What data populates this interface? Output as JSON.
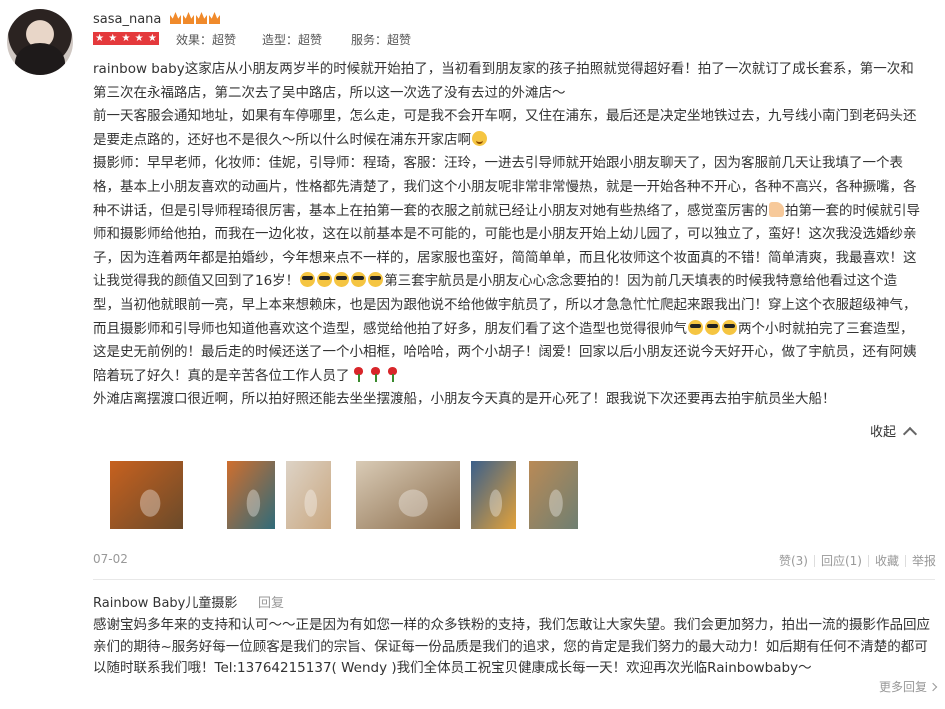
{
  "user": {
    "name": "sasa_nana",
    "crown_count": 4,
    "star_rating": 5,
    "ratings": [
      {
        "label": "效果：超赞"
      },
      {
        "label": "造型：超赞"
      },
      {
        "label": "服务：超赞"
      }
    ]
  },
  "review": {
    "paragraphs": [
      "rainbow baby这家店从小朋友两岁半的时候就开始拍了，当初看到朋友家的孩子拍照就觉得超好看！拍了一次就订了成长套系，第一次和第三次在永福路店，第二次去了吴中路店，所以这一次选了没有去过的外滩店～",
      "前一天客服会通知地址，如果有车停哪里，怎么走，可是我不会开车啊，又住在浦东，最后还是决定坐地铁过去，九号线小南门到老码头还是要走点路的，还好也不是很久～所以什么时候在浦东开家店啊",
      "摄影师：早早老师，化妆师：佳妮，引导师：程琦，客服：汪玲，一进去引导师就开始跟小朋友聊天了，因为客服前几天让我填了一个表格，基本上小朋友喜欢的动画片，性格都先清楚了，我们这个小朋友呢非常非常慢热，就是一开始各种不开心，各种不高兴，各种撅嘴，各种不讲话，但是引导师程琦很厉害，基本上在拍第一套的衣服之前就已经让小朋友对她有些热络了，感觉蛮厉害的",
      "拍第一套的时候就引导师和摄影师给他拍，而我在一边化妆，这在以前基本是不可能的，可能也是小朋友开始上幼儿园了，可以独立了，蛮好！这次我没选婚纱亲子，因为连着两年都是拍婚纱，今年想来点不一样的，居家服也蛮好，简简单单，而且化妆师这个妆面真的不错！简单清爽，我最喜欢！这让我觉得我的颜值又回到了16岁！",
      "第三套宇航员是小朋友心心念念要拍的！因为前几天填表的时候我特意给他看过这个造型，当初他就眼前一亮，早上本来想赖床，也是因为跟他说不给他做宇航员了，所以才急急忙忙爬起来跟我出门！穿上这个衣服超级神气，而且摄影师和引导师也知道他喜欢这个造型，感觉给他拍了好多，朋友们看了这个造型也觉得很帅气",
      "两个小时就拍完了三套造型，这是史无前例的！最后走的时候还送了一个小相框，哈哈哈，两个小胡子！阔爱！回家以后小朋友还说今天好开心，做了宇航员，还有阿姨陪着玩了好久！真的是辛苦各位工作人员了",
      "外滩店离摆渡口很近啊，所以拍好照还能去坐坐摆渡船，小朋友今天真的是开心死了！跟我说下次还要再去拍宇航员坐大船！"
    ],
    "collapse_label": "收起",
    "date": "07-02",
    "actions": {
      "like": "赞(3)",
      "reply": "回应(1)",
      "favorite": "收藏",
      "report": "举报"
    }
  },
  "photos": [
    {
      "name": "boy-orange-background",
      "colors": [
        "#c7611f",
        "#6a4a2a"
      ]
    },
    {
      "name": "boy-window-orange",
      "colors": [
        "#cf6e2e",
        "#2f6b7a"
      ]
    },
    {
      "name": "boy-studio-light",
      "colors": [
        "#ddd3c6",
        "#c9a780"
      ]
    },
    {
      "name": "living-room-set",
      "colors": [
        "#d9cbb6",
        "#8a6c4b"
      ]
    },
    {
      "name": "boy-astronaut",
      "colors": [
        "#3b5f8a",
        "#e3a23a"
      ]
    },
    {
      "name": "boy-retro-room",
      "colors": [
        "#b98a56",
        "#6f7f72"
      ]
    }
  ],
  "shop_reply": {
    "name": "Rainbow Baby儿童摄影",
    "reply_label": "回复",
    "text": "感谢宝妈多年来的支持和认可～～正是因为有如您一样的众多铁粉的支持，我们怎敢让大家失望。我们会更加努力，拍出一流的摄影作品回应亲们的期待~服务好每一位顾客是我们的宗旨、保证每一份品质是我们的追求，您的肯定是我们努力的最大动力！如后期有任何不清楚的都可以随时联系我们哦！Tel:13764215137( Wendy )我们全体员工祝宝贝健康成长每一天！欢迎再次光临Rainbowbaby～",
    "more_label": "更多回复"
  }
}
